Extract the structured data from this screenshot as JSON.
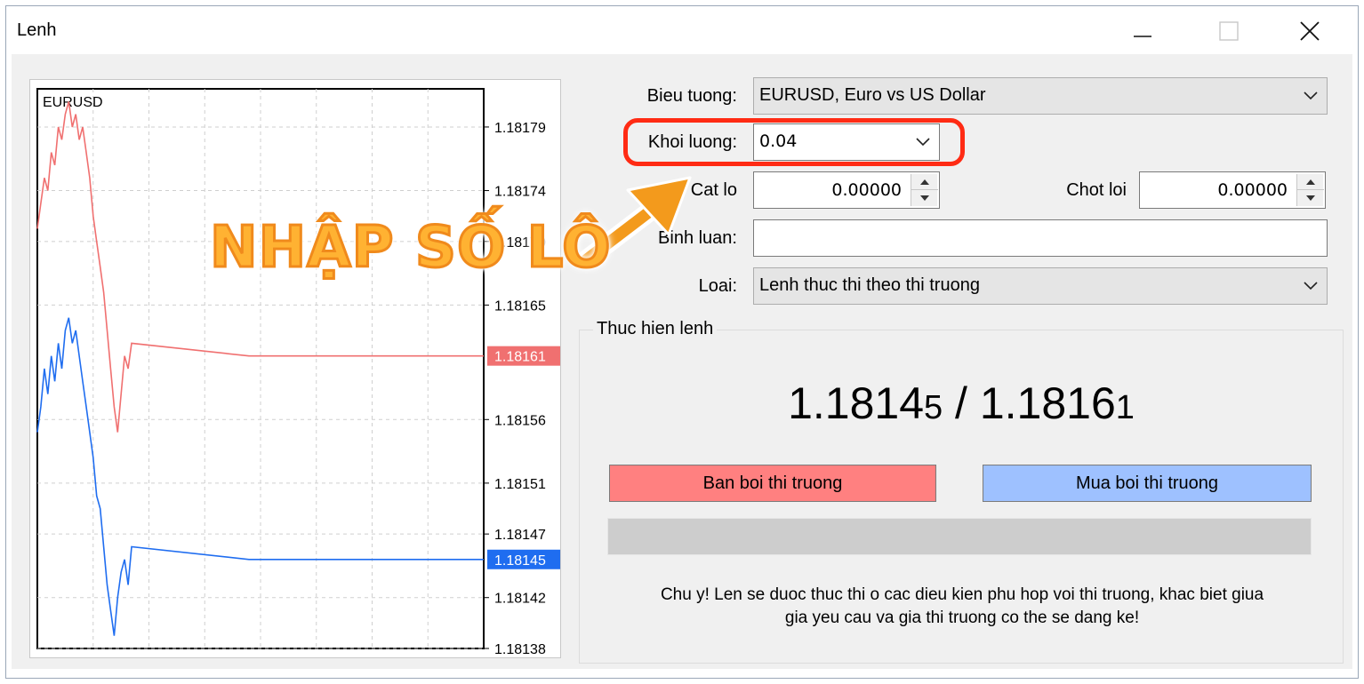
{
  "window": {
    "title": "Lenh"
  },
  "chart": {
    "symbol": "EURUSD",
    "bid_label": "1.18145",
    "ask_label": "1.18161",
    "colors": {
      "bid": "#1f6df0",
      "ask": "#f07070",
      "grid": "#cfcfcf"
    }
  },
  "chart_data": {
    "type": "line",
    "title": "EURUSD",
    "y_ticks": [
      "1.18179",
      "1.18174",
      "1.18170",
      "1.18165",
      "1.18156",
      "1.18151",
      "1.18147",
      "1.18142",
      "1.18138"
    ],
    "ylim": [
      1.18138,
      1.18182
    ],
    "grid": true,
    "series": [
      {
        "name": "ask",
        "values": [
          1.18171,
          1.18173,
          1.18175,
          1.18174,
          1.18177,
          1.18176,
          1.18179,
          1.18178,
          1.1818,
          1.18181,
          1.18179,
          1.1818,
          1.18178,
          1.18179,
          1.18177,
          1.18175,
          1.18172,
          1.1817,
          1.18168,
          1.18166,
          1.18163,
          1.1816,
          1.18157,
          1.18155,
          1.18158,
          1.18161,
          1.1816,
          1.18162,
          1.18161,
          1.18161,
          1.18161
        ]
      },
      {
        "name": "bid",
        "values": [
          1.18155,
          1.18157,
          1.1816,
          1.18158,
          1.18161,
          1.18159,
          1.18162,
          1.1816,
          1.18163,
          1.18164,
          1.18162,
          1.18163,
          1.18161,
          1.18159,
          1.18157,
          1.18155,
          1.18153,
          1.1815,
          1.18149,
          1.18146,
          1.18143,
          1.18141,
          1.18139,
          1.18142,
          1.18144,
          1.18145,
          1.18143,
          1.18146,
          1.18145,
          1.18145,
          1.18145
        ]
      }
    ]
  },
  "form": {
    "symbol_label": "Bieu tuong:",
    "symbol_value": "EURUSD, Euro vs US Dollar",
    "volume_label": "Khoi luong:",
    "volume_value": "0.04",
    "stoploss_label": "Cat lo",
    "stoploss_value": "0.00000",
    "takeprofit_label": "Chot loi",
    "takeprofit_value": "0.00000",
    "comment_label": "Binh luan:",
    "comment_value": "",
    "type_label": "Loai:",
    "type_value": "Lenh thuc thi theo thi truong"
  },
  "execution": {
    "group_title": "Thuc hien lenh",
    "bid_main": "1.1814",
    "bid_small": "5",
    "separator": " / ",
    "ask_main": "1.1816",
    "ask_small": "1",
    "sell_label": "Ban boi thi truong",
    "buy_label": "Mua boi thi truong",
    "progress": 0,
    "notice_line1": "Chu y! Len se duoc thuc thi o cac dieu kien phu hop voi thi truong, khac biet giua",
    "notice_line2": "gia yeu cau va gia thi truong co the se dang ke!"
  },
  "annotation": {
    "text": "NHẬP SỐ LÔ",
    "color": "#f59a1c",
    "highlight_color": "#ff2b14"
  },
  "icons": {
    "minimize": "minimize-icon",
    "maximize": "maximize-icon",
    "close": "close-icon",
    "dropdown": "chevron-down-icon",
    "spin": "spin-arrows-icon"
  }
}
